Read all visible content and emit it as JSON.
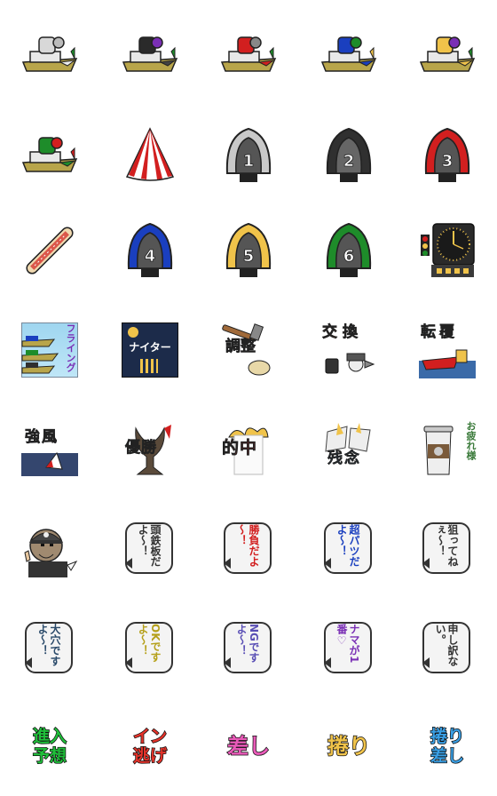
{
  "title": "",
  "colors": {
    "boat1": "#c9c9c9",
    "boat2": "#303030",
    "boat3": "#d21f1f",
    "boat4": "#1a3fbf",
    "boat5": "#f0c34a",
    "boat6": "#1e8c2a",
    "hull": "#b8a54a"
  },
  "row1": [
    {
      "name": "race-boat-white-icon"
    },
    {
      "name": "race-boat-purple-icon"
    },
    {
      "name": "race-boat-red-icon"
    },
    {
      "name": "race-boat-blue-icon"
    },
    {
      "name": "race-boat-yellow-icon"
    }
  ],
  "row2": {
    "boat_numbers": [
      "1",
      "2",
      "3"
    ]
  },
  "row3": {
    "boat_numbers": [
      "4",
      "5",
      "6"
    ]
  },
  "row4": {
    "flying": "フライング",
    "nighter": "ナイター",
    "adjust": "調整",
    "exchange": "交換",
    "capsize": "転覆"
  },
  "row5": {
    "strong_wind": "強風",
    "victory": "優勝",
    "hit": "的中",
    "regret": "残念",
    "thanks": "お疲れ様"
  },
  "row6": {
    "bubbles": [
      "頭鉄板だよ～！",
      "勝負だよ～！",
      "超パツだよ～！",
      "狙ってねぇ～！"
    ]
  },
  "row7": {
    "bubbles": [
      "大穴ですよ～！",
      "OKですよ～！",
      "NGですよ～！",
      "ナマが1番♡",
      "申し訳ない。"
    ]
  },
  "row8": {
    "words": [
      "進入予想",
      "イン逃げ",
      "差し",
      "捲り",
      "捲り差し"
    ]
  }
}
